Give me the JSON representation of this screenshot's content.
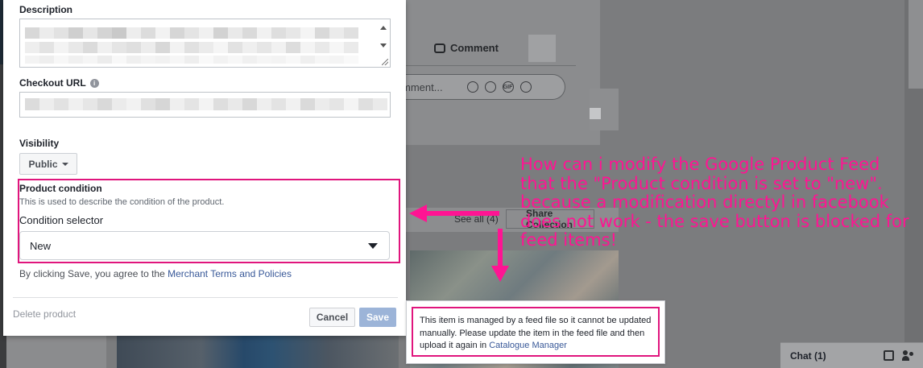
{
  "modal": {
    "description_label": "Description",
    "checkout_url_label": "Checkout URL",
    "visibility_label": "Visibility",
    "visibility_value": "Public",
    "product_condition_title": "Product condition",
    "product_condition_desc": "This is used to describe the condition of the product.",
    "condition_selector_label": "Condition selector",
    "condition_value": "New",
    "terms_prefix": "By clicking Save, you agree to the ",
    "terms_link": "Merchant Terms and Policies",
    "delete_label": "Delete product",
    "cancel_label": "Cancel",
    "save_label": "Save"
  },
  "tooltip": {
    "text": "This item is managed by a feed file so it cannot be updated manually. Please update the item in the feed file and then upload it again in ",
    "link": "Catalogue Manager"
  },
  "background": {
    "comment_label": "Comment",
    "comment_placeholder": "mment...",
    "see_all": "See all (4)",
    "share_collection": "Share Collection",
    "chat_label": "Chat (1)",
    "gif_label": "GIF"
  },
  "annotation": {
    "lines": [
      "How can i modify the Google Product Feed",
      "that the \"Product condition is set to \"new\".",
      "because a modification directyl in facebook",
      "does not work - the save button is blocked for",
      "feed items!"
    ]
  },
  "colors": {
    "highlight": "#e0157d",
    "annotation": "#ff1493",
    "link": "#385898",
    "save_disabled": "#9cb4d8"
  }
}
